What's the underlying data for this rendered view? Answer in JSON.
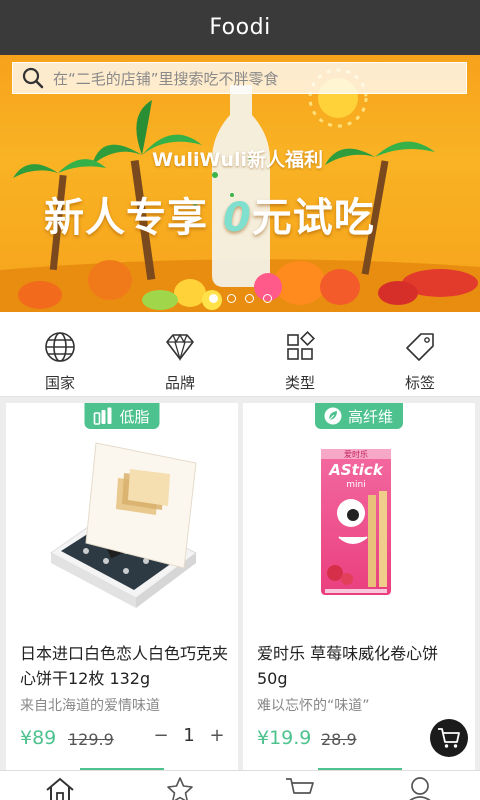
{
  "app": {
    "title": "Foodi"
  },
  "search": {
    "placeholder": "在“二毛的店铺”里搜索吃不胖零食"
  },
  "banner": {
    "subtitle": "WuliWuli新人福利",
    "headline_a": "新人专享",
    "headline_zero": "0",
    "headline_b": "元试吃",
    "slides": 4,
    "active_slide": 0
  },
  "categories": [
    {
      "label": "国家",
      "icon": "globe-icon"
    },
    {
      "label": "品牌",
      "icon": "diamond-icon"
    },
    {
      "label": "类型",
      "icon": "grid-icon"
    },
    {
      "label": "标签",
      "icon": "tag-icon"
    }
  ],
  "products": [
    {
      "tag": "低脂",
      "tag_icon": "bar-chart-icon",
      "name": "日本进口白色恋人白色巧克夹心饼干12枚 132g",
      "desc": "来自北海道的爱情味道",
      "price": "¥89",
      "old_price": "129.9",
      "qty": "1",
      "minus": "−",
      "plus": "+"
    },
    {
      "tag": "高纤维",
      "tag_icon": "leaf-icon",
      "name": "爱时乐 草莓味威化卷心饼50g",
      "desc": "难以忘怀的“味道”",
      "price": "¥19.9",
      "old_price": "28.9",
      "package_brand": "AStick",
      "package_sub": "mini",
      "package_top": "爱时乐"
    }
  ],
  "bottom_nav": [
    {
      "icon": "home-icon"
    },
    {
      "icon": "star-icon"
    },
    {
      "icon": "cart-icon"
    },
    {
      "icon": "user-icon"
    }
  ],
  "colors": {
    "accent": "#4dc28e",
    "titlebar": "#3a3a3a",
    "banner": "#f7a21b"
  }
}
